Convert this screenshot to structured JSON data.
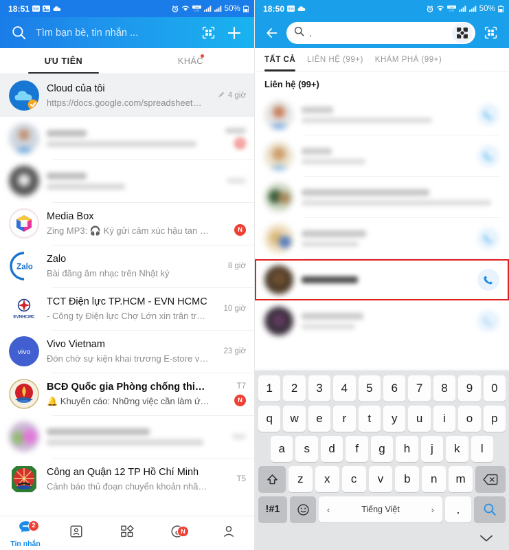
{
  "left": {
    "status_bar": {
      "time": "18:51",
      "battery": "50%",
      "icons": [
        "sim-icon",
        "photo-icon",
        "cloud-icon",
        "alarm-icon",
        "wifi-icon",
        "vol-icon",
        "signal-icon",
        "signal2-icon",
        "battery-icon"
      ]
    },
    "header": {
      "search_placeholder": "Tìm bạn bè, tin nhắn ...",
      "qr_icon": "qr-scan-icon",
      "add_icon": "plus-icon",
      "search_icon": "search-icon"
    },
    "tabs": [
      {
        "label": "ƯU TIÊN",
        "active": true,
        "dot": false
      },
      {
        "label": "KHÁC",
        "active": false,
        "dot": true
      }
    ],
    "chats": [
      {
        "title": "Cloud của tôi",
        "subtitle": "https://docs.google.com/spreadsheets/d...",
        "time": "4 giờ",
        "pinned": true,
        "blurred": false,
        "badge": "",
        "avatar": "cloud-avatar"
      },
      {
        "title": "",
        "subtitle": "",
        "time": "",
        "pinned": false,
        "blurred": true,
        "badge": "N",
        "avatar": "blurred-avatar"
      },
      {
        "title": "",
        "subtitle": "",
        "time": "",
        "pinned": false,
        "blurred": true,
        "badge": "",
        "avatar": "blurred-avatar"
      },
      {
        "title": "Media Box",
        "subtitle": "Zing MP3: 🎧 Ký gửi cảm xúc hậu tan vỡ...",
        "time": "",
        "pinned": false,
        "blurred": false,
        "badge": "N",
        "avatar": "mediabox-avatar"
      },
      {
        "title": "Zalo",
        "subtitle": "Bài đăng âm nhạc trên Nhật ký",
        "time": "8 giờ",
        "pinned": false,
        "blurred": false,
        "badge": "",
        "avatar": "zalo-avatar"
      },
      {
        "title": "TCT Điện lực TP.HCM - EVN HCMC",
        "subtitle": "- Công ty Điện lực Chợ Lớn xin trân trọng...",
        "time": "10 giờ",
        "pinned": false,
        "blurred": false,
        "badge": "",
        "avatar": "evn-avatar"
      },
      {
        "title": "Vivo Vietnam",
        "subtitle": "Đón chờ sự kiện khai trương E-store vivo Việt...",
        "time": "23 giờ",
        "pinned": false,
        "blurred": false,
        "badge": "",
        "avatar": "vivo-avatar"
      },
      {
        "title": "BCĐ Quốc gia Phòng chống thiên tai",
        "subtitle": "🔔 Khuyến cáo: Những việc cần làm ứng...",
        "time": "T7",
        "pinned": false,
        "blurred": false,
        "badge": "N",
        "avatar": "bcd-avatar"
      },
      {
        "title": "",
        "subtitle": "",
        "time": "",
        "pinned": false,
        "blurred": true,
        "badge": "",
        "avatar": "blurred-avatar"
      },
      {
        "title": "Công an Quận 12 TP Hồ Chí Minh",
        "subtitle": "Cảnh báo thủ đoạn chuyển khoản nhầm để lừa...",
        "time": "T5",
        "pinned": false,
        "blurred": false,
        "badge": "",
        "avatar": "congan-avatar"
      }
    ],
    "bottom_nav": [
      {
        "label": "Tin nhắn",
        "icon": "message-icon",
        "badge": "2",
        "active": true
      },
      {
        "label": "",
        "icon": "contacts-icon",
        "badge": "",
        "active": false
      },
      {
        "label": "",
        "icon": "apps-grid-icon",
        "badge": "",
        "active": false
      },
      {
        "label": "",
        "icon": "diary-icon",
        "badge": "N",
        "active": false
      },
      {
        "label": "",
        "icon": "person-icon",
        "badge": "",
        "active": false
      }
    ]
  },
  "right": {
    "status_bar": {
      "time": "18:50",
      "battery": "50%"
    },
    "header": {
      "back_icon": "back-arrow-icon",
      "search_value": ".",
      "search_icon": "search-icon",
      "camera_icon": "image-search-icon",
      "qr_icon": "qr-scan-icon"
    },
    "tabs": [
      {
        "label": "TẤT CẢ",
        "active": true
      },
      {
        "label": "LIÊN HỆ (99+)",
        "active": false
      },
      {
        "label": "KHÁM PHÁ (99+)",
        "active": false
      }
    ],
    "section_title": "Liên hệ (99+)",
    "contacts": [
      {
        "name": "",
        "sub": "",
        "blurred": true,
        "highlighted": false,
        "action": "call-icon"
      },
      {
        "name": "",
        "sub": "",
        "blurred": true,
        "highlighted": false,
        "action": "call-icon"
      },
      {
        "name": "",
        "sub": "",
        "blurred": true,
        "highlighted": false,
        "action": ""
      },
      {
        "name": "",
        "sub": "",
        "blurred": true,
        "highlighted": false,
        "action": "call-icon"
      },
      {
        "name": "",
        "sub": "",
        "blurred": true,
        "highlighted": true,
        "action": "call-icon"
      },
      {
        "name": "",
        "sub": "",
        "blurred": true,
        "highlighted": false,
        "action": "call-icon"
      }
    ],
    "keyboard": {
      "row_numbers": [
        "1",
        "2",
        "3",
        "4",
        "5",
        "6",
        "7",
        "8",
        "9",
        "0"
      ],
      "row1": [
        "q",
        "w",
        "e",
        "r",
        "t",
        "y",
        "u",
        "i",
        "o",
        "p"
      ],
      "row2": [
        "a",
        "s",
        "d",
        "f",
        "g",
        "h",
        "j",
        "k",
        "l"
      ],
      "row3": [
        "z",
        "x",
        "c",
        "v",
        "b",
        "n",
        "m"
      ],
      "shift_icon": "shift-icon",
      "backspace_icon": "backspace-icon",
      "symbols_label": "!#1",
      "emoji_icon": "emoji-icon",
      "space_label": "Tiếng Việt",
      "space_prev": "‹",
      "space_next": "›",
      "period_label": ".",
      "search_key_icon": "search-icon",
      "hide_keyboard_icon": "chevron-down-icon"
    }
  },
  "colors": {
    "accent_blue": "#1a8ce8",
    "header_gradient_start": "#1a7ce8",
    "header_gradient_end": "#19b3f0",
    "right_header": "#1a9fea",
    "badge_red": "#ef4034",
    "highlight_red": "#e02020",
    "keyboard_bg": "#e3e4e6"
  }
}
